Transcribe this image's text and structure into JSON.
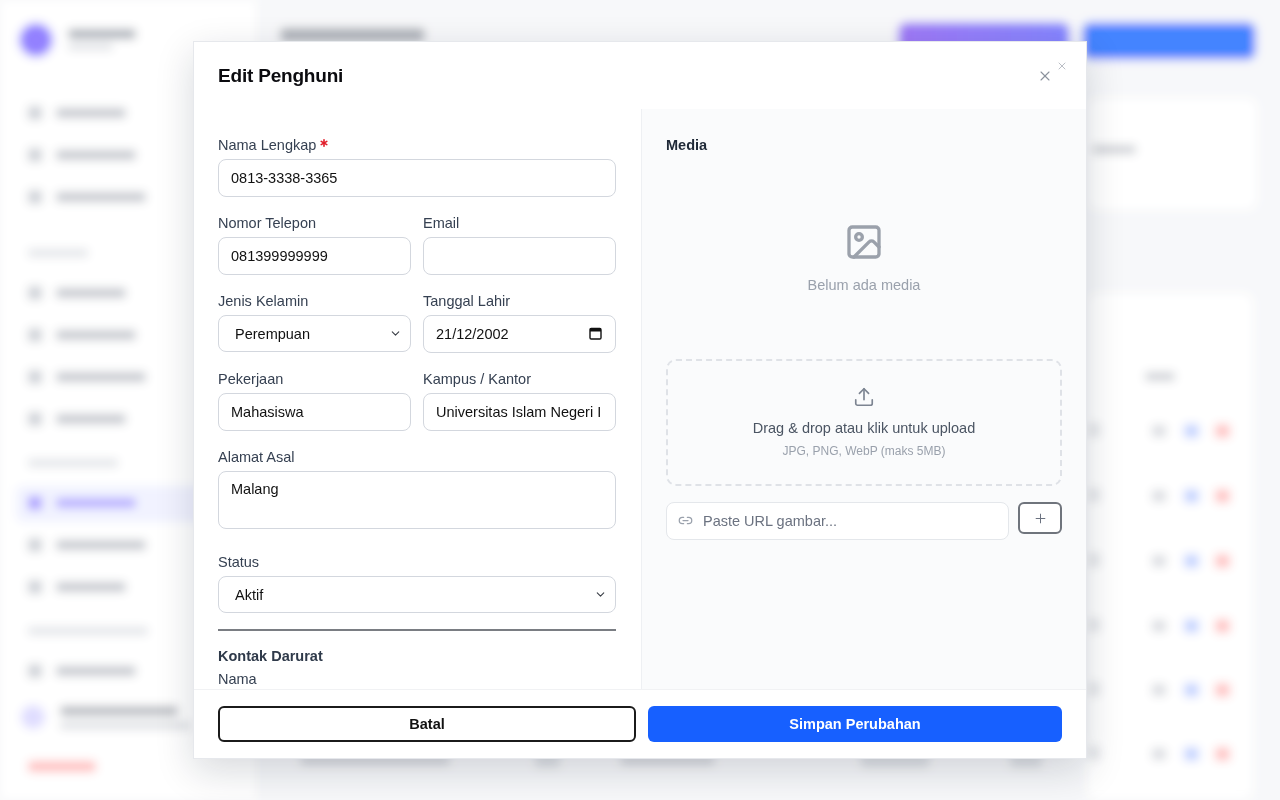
{
  "dialog": {
    "title": "Edit Penghuni",
    "form": {
      "rows": [
        [
          {
            "kind": "text",
            "label": "Nama Lengkap",
            "required": true,
            "value": "0813-3338-3365"
          }
        ],
        [
          {
            "kind": "text",
            "label": "Nomor Telepon",
            "required": false,
            "value": "081399999999"
          },
          {
            "kind": "text",
            "label": "Email",
            "required": false
          }
        ],
        [
          {
            "kind": "select",
            "label": "Jenis Kelamin",
            "required": false,
            "value": "Perempuan"
          },
          {
            "kind": "date",
            "label": "Tanggal Lahir",
            "required": false,
            "value": "21/12/2002"
          }
        ],
        [
          {
            "kind": "text",
            "label": "Pekerjaan",
            "required": false,
            "value": "Mahasiswa"
          },
          {
            "kind": "text",
            "label": "Kampus / Kantor",
            "required": false,
            "value": "Universitas Islam Negeri I"
          }
        ],
        [
          {
            "kind": "textarea",
            "label": "Alamat Asal",
            "required": false,
            "value": "Malang"
          }
        ],
        [
          {
            "kind": "select",
            "label": "Status",
            "required": false,
            "value": "Aktif"
          }
        ]
      ],
      "section_title": "Kontak Darurat",
      "section_fields": [
        {
          "label": "Nama"
        }
      ]
    },
    "media": {
      "title": "Media",
      "empty_text": "Belum ada media",
      "upload_text": "Drag & drop atau klik untuk upload",
      "upload_hint": "JPG, PNG, WebP (maks 5MB)",
      "url_placeholder": "Paste URL gambar..."
    },
    "buttons": [
      {
        "kind": "secondary",
        "label": "Batal"
      },
      {
        "kind": "primary",
        "label": "Simpan Perubahan"
      }
    ]
  }
}
